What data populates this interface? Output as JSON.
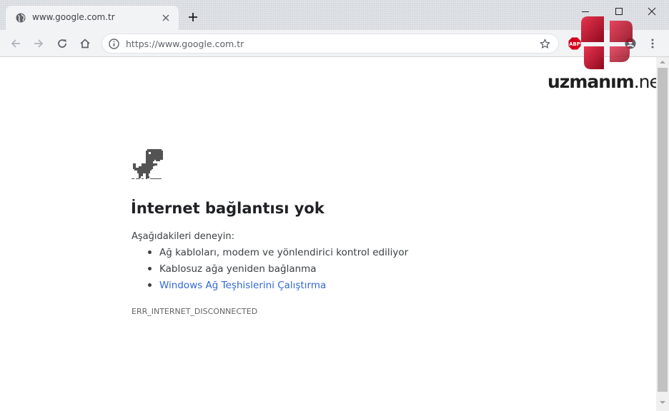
{
  "tab": {
    "title": "www.google.com.tr"
  },
  "omnibox": {
    "url": "https://www.google.com.tr"
  },
  "extensions": {
    "adblock_label": "ABP"
  },
  "watermark": {
    "brand": "uzmanım",
    "tld": ".net"
  },
  "error": {
    "title": "İnternet bağlantısı yok",
    "suggestions_intro": "Aşağıdakileri deneyin:",
    "suggestions": [
      "Ağ kabloları, modem ve yönlendirici kontrol ediliyor",
      "Kablosuz ağa yeniden bağlanma",
      "Windows Ağ Teşhislerini Çalıştırma"
    ],
    "code": "ERR_INTERNET_DISCONNECTED"
  },
  "colors": {
    "link": "#3367d6",
    "logo_red": "#c8102e",
    "abp_red": "#d0021b"
  }
}
